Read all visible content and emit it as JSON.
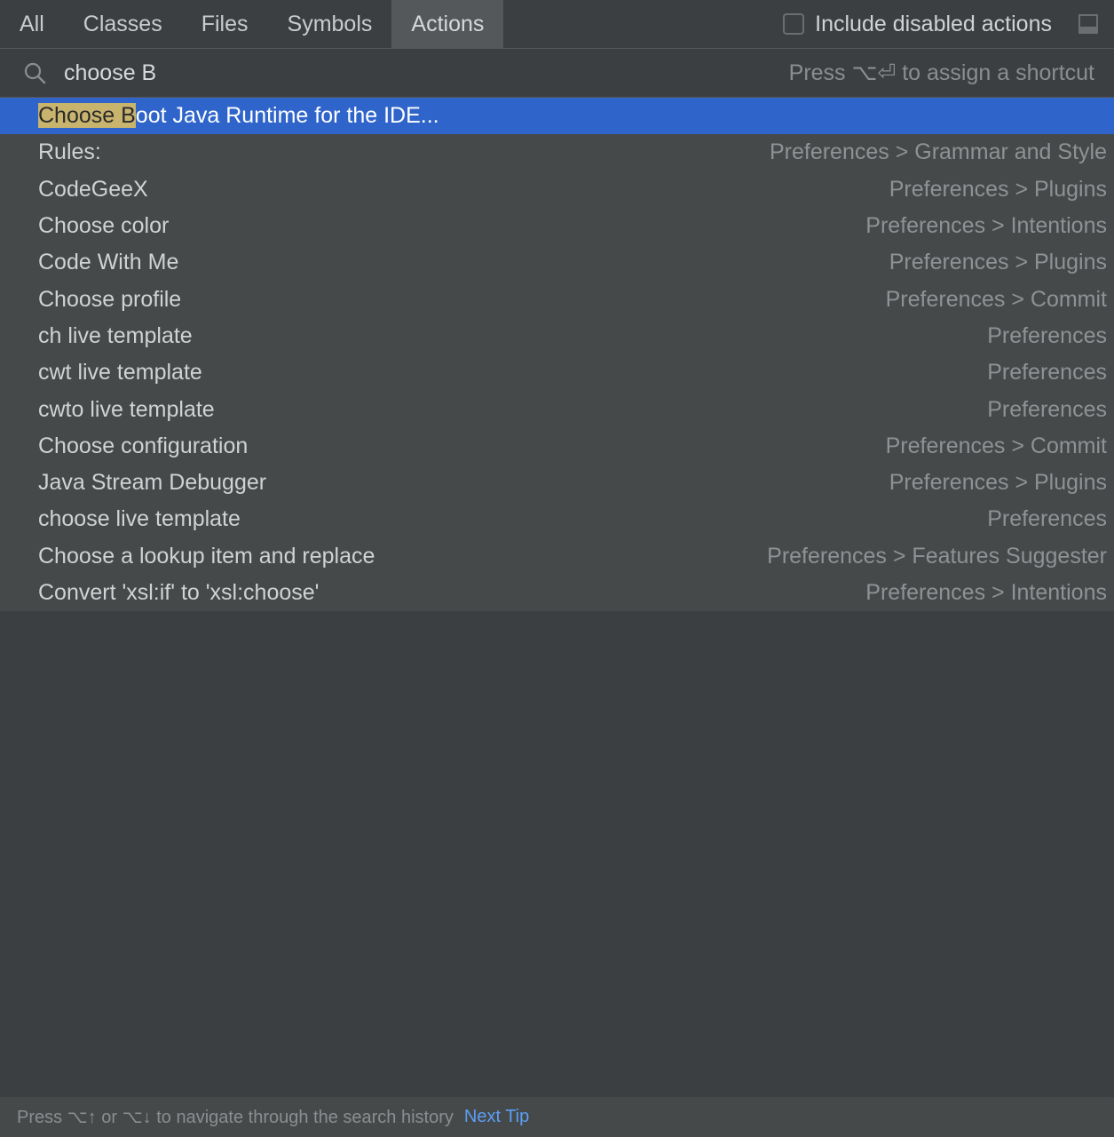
{
  "tabs": [
    "All",
    "Classes",
    "Files",
    "Symbols",
    "Actions"
  ],
  "active_tab": "Actions",
  "include_disabled": {
    "label": "Include disabled actions",
    "checked": false
  },
  "search": {
    "value": "choose B",
    "hint": "Press ⌥⏎ to assign a shortcut"
  },
  "selected": {
    "match": "Choose B",
    "rest": "oot Java Runtime for the IDE...",
    "location": ""
  },
  "results": [
    {
      "name": "Rules:",
      "location": "Preferences > Grammar and Style"
    },
    {
      "name": "CodeGeeX",
      "location": "Preferences > Plugins"
    },
    {
      "name": "Choose color",
      "location": "Preferences > Intentions"
    },
    {
      "name": "Code With Me",
      "location": "Preferences > Plugins"
    },
    {
      "name": "Choose profile",
      "location": "Preferences > Commit"
    },
    {
      "name": "ch live template",
      "location": "Preferences"
    },
    {
      "name": "cwt live template",
      "location": "Preferences"
    },
    {
      "name": "cwto live template",
      "location": "Preferences"
    },
    {
      "name": "Choose configuration",
      "location": "Preferences > Commit"
    },
    {
      "name": "Java Stream Debugger",
      "location": "Preferences > Plugins"
    },
    {
      "name": "choose live template",
      "location": "Preferences"
    },
    {
      "name": "Choose a lookup item and replace",
      "location": "Preferences > Features Suggester"
    },
    {
      "name": "Convert 'xsl:if' to 'xsl:choose'",
      "location": "Preferences > Intentions"
    }
  ],
  "footer": {
    "text": "Press ⌥↑ or ⌥↓ to navigate through the search history",
    "link": "Next Tip"
  },
  "colors": {
    "selection": "#2f65ca",
    "highlight": "#c9b46e",
    "link": "#5c9ef5"
  },
  "icons": {
    "search": "search-icon",
    "panel": "panel-toggle-icon"
  }
}
